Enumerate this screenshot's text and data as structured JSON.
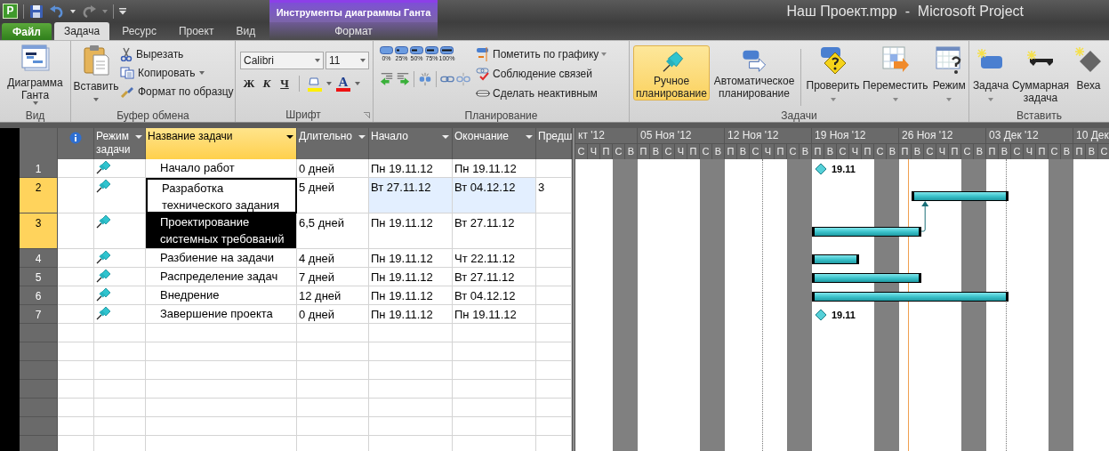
{
  "quick_access": {
    "logo": "P"
  },
  "window_title": "Наш Проект.mpp  -  Microsoft Project",
  "contextual_group": {
    "title": "Инструменты диаграммы Ганта",
    "tabs": [
      {
        "label": "Формат",
        "selected": false
      }
    ]
  },
  "tabs": [
    {
      "label": "Файл",
      "kind": "file",
      "selected": false
    },
    {
      "label": "Задача",
      "kind": "tab",
      "selected": true
    },
    {
      "label": "Ресурс",
      "kind": "tab",
      "selected": false
    },
    {
      "label": "Проект",
      "kind": "tab",
      "selected": false
    },
    {
      "label": "Вид",
      "kind": "tab",
      "selected": false
    }
  ],
  "ribbon": {
    "view": {
      "label": "Вид",
      "gantt": "Диаграмма Ганта"
    },
    "clipboard": {
      "label": "Буфер обмена",
      "paste": "Вставить",
      "cut": "Вырезать",
      "copy": "Копировать",
      "format_painter": "Формат по образцу"
    },
    "font": {
      "label": "Шрифт",
      "font_name": "Calibri",
      "font_size": "11",
      "bold": "Ж",
      "italic": "К",
      "underline": "Ч",
      "font_color": "A"
    },
    "schedule": {
      "label": "Планирование",
      "percent_buttons": [
        "0%",
        "25%",
        "50%",
        "75%",
        "100%"
      ],
      "mark_on_track": "Пометить по графику",
      "respect_links": "Соблюдение связей",
      "inactivate": "Сделать неактивным"
    },
    "tasks": {
      "label": "Задачи",
      "modes": [
        {
          "label": "Ручное планирование",
          "selected": true
        },
        {
          "label": "Автоматическое планирование",
          "selected": false
        }
      ],
      "inspect": "Проверить",
      "move": "Переместить",
      "mode": "Режим"
    },
    "insert": {
      "label": "Вставить",
      "task": "Задача",
      "summary": "Суммарная задача",
      "milestone": "Веха"
    }
  },
  "table": {
    "columns": [
      {
        "label": "Режим задачи",
        "selected": false
      },
      {
        "label": "Название задачи",
        "selected": true
      },
      {
        "label": "Длительно",
        "selected": false
      },
      {
        "label": "Начало",
        "selected": false
      },
      {
        "label": "Окончание",
        "selected": false
      },
      {
        "label": "Предш",
        "selected": false
      }
    ],
    "rows": [
      {
        "id": "1",
        "kind": "milestone",
        "name": "Начало работ",
        "duration": "0 дней",
        "start": "Пн 19.11.12",
        "finish": "Пн 19.11.12",
        "milestone_label": "19.11",
        "selected": false,
        "name_active": false,
        "name_highlighted": false,
        "dates_changed": false
      },
      {
        "id": "2",
        "kind": "task",
        "name": "Разработка технического задания",
        "duration": "5 дней",
        "start": "Вт 27.11.12",
        "finish": "Вт 04.12.12",
        "predecessors": "3",
        "selected": true,
        "name_active": true,
        "name_highlighted": false,
        "dates_changed": true
      },
      {
        "id": "3",
        "kind": "task",
        "name": "Проектирование системных требований",
        "duration": "6,5 дней",
        "start": "Пн 19.11.12",
        "finish": "Вт 27.11.12",
        "selected": true,
        "name_active": false,
        "name_highlighted": true,
        "dates_changed": false
      },
      {
        "id": "4",
        "kind": "task",
        "name": "Разбиение на задачи",
        "duration": "4 дней",
        "start": "Пн 19.11.12",
        "finish": "Чт 22.11.12",
        "selected": false,
        "name_active": false,
        "name_highlighted": false,
        "dates_changed": false
      },
      {
        "id": "5",
        "kind": "task",
        "name": "Распределение задач",
        "duration": "7 дней",
        "start": "Пн 19.11.12",
        "finish": "Вт 27.11.12",
        "selected": false,
        "name_active": false,
        "name_highlighted": false,
        "dates_changed": false
      },
      {
        "id": "6",
        "kind": "task",
        "name": "Внедрение",
        "duration": "12 дней",
        "start": "Пн 19.11.12",
        "finish": "Вт 04.12.12",
        "selected": false,
        "name_active": false,
        "name_highlighted": false,
        "dates_changed": false
      },
      {
        "id": "7",
        "kind": "milestone",
        "name": "Завершение проекта",
        "duration": "0 дней",
        "start": "Пн 19.11.12",
        "finish": "Пн 19.11.12",
        "milestone_label": "19.11",
        "selected": false,
        "name_active": false,
        "name_highlighted": false,
        "dates_changed": false
      }
    ]
  },
  "timescale": {
    "weeks": [
      {
        "label": "кт '12",
        "days": [
          {
            "letter": "С",
            "weekend": false
          },
          {
            "letter": "Ч",
            "weekend": false
          },
          {
            "letter": "П",
            "weekend": false
          },
          {
            "letter": "С",
            "weekend": true
          },
          {
            "letter": "В",
            "weekend": true
          }
        ]
      },
      {
        "label": "05 Ноя '12",
        "days": [
          {
            "letter": "П",
            "weekend": false
          },
          {
            "letter": "В",
            "weekend": false
          },
          {
            "letter": "С",
            "weekend": false
          },
          {
            "letter": "Ч",
            "weekend": false
          },
          {
            "letter": "П",
            "weekend": false
          },
          {
            "letter": "С",
            "weekend": true
          },
          {
            "letter": "В",
            "weekend": true
          }
        ]
      },
      {
        "label": "12 Ноя '12",
        "days": [
          {
            "letter": "П",
            "weekend": false
          },
          {
            "letter": "В",
            "weekend": false
          },
          {
            "letter": "С",
            "weekend": false
          },
          {
            "letter": "Ч",
            "weekend": false
          },
          {
            "letter": "П",
            "weekend": false
          },
          {
            "letter": "С",
            "weekend": true
          },
          {
            "letter": "В",
            "weekend": true
          }
        ]
      },
      {
        "label": "19 Ноя '12",
        "days": [
          {
            "letter": "П",
            "weekend": false
          },
          {
            "letter": "В",
            "weekend": false
          },
          {
            "letter": "С",
            "weekend": false
          },
          {
            "letter": "Ч",
            "weekend": false
          },
          {
            "letter": "П",
            "weekend": false
          },
          {
            "letter": "С",
            "weekend": true
          },
          {
            "letter": "В",
            "weekend": true
          }
        ]
      },
      {
        "label": "26 Ноя '12",
        "days": [
          {
            "letter": "П",
            "weekend": false
          },
          {
            "letter": "В",
            "weekend": false
          },
          {
            "letter": "С",
            "weekend": false
          },
          {
            "letter": "Ч",
            "weekend": false
          },
          {
            "letter": "П",
            "weekend": false
          },
          {
            "letter": "С",
            "weekend": true
          },
          {
            "letter": "В",
            "weekend": true
          }
        ]
      },
      {
        "label": "03 Дек '12",
        "days": [
          {
            "letter": "П",
            "weekend": false
          },
          {
            "letter": "В",
            "weekend": false
          },
          {
            "letter": "С",
            "weekend": false
          },
          {
            "letter": "Ч",
            "weekend": false
          },
          {
            "letter": "П",
            "weekend": false
          },
          {
            "letter": "С",
            "weekend": true
          },
          {
            "letter": "В",
            "weekend": true
          }
        ]
      },
      {
        "label": "10 Дек",
        "days": [
          {
            "letter": "П",
            "weekend": false
          },
          {
            "letter": "В",
            "weekend": false
          },
          {
            "letter": "С",
            "weekend": false
          }
        ]
      }
    ]
  }
}
